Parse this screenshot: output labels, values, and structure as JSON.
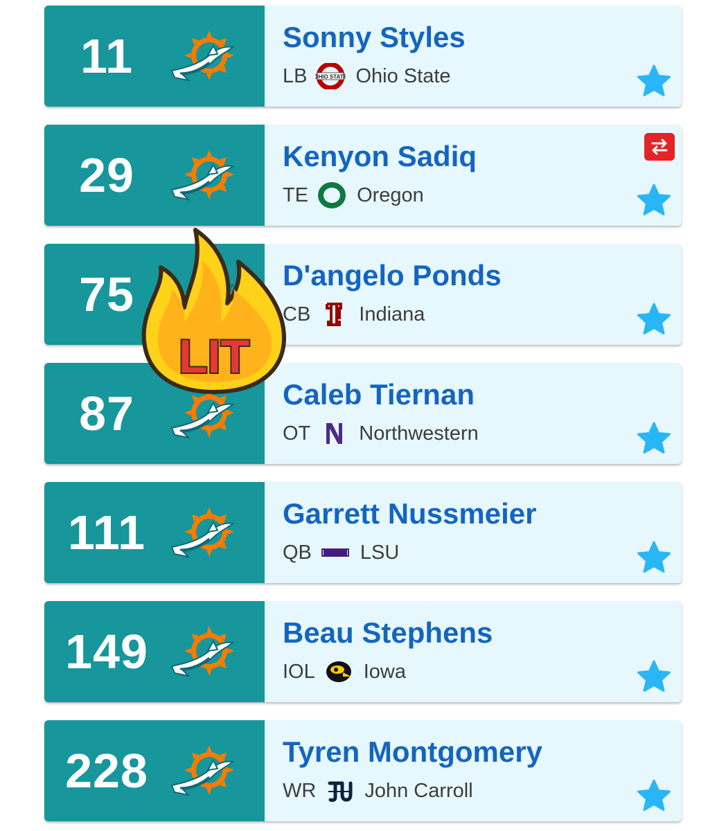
{
  "colors": {
    "team_panel": "#17969b",
    "card_bg": "#e6f8fd",
    "name_blue": "#1565c0",
    "star": "#29b6f6",
    "trade_red": "#e42327"
  },
  "sticker": {
    "text": "LIT"
  },
  "picks": [
    {
      "pick": "11",
      "name": "Sonny Styles",
      "position": "LB",
      "school": "Ohio State",
      "school_icon": "ohio-state-logo-icon",
      "trade": false
    },
    {
      "pick": "29",
      "name": "Kenyon Sadiq",
      "position": "TE",
      "school": "Oregon",
      "school_icon": "oregon-logo-icon",
      "trade": true
    },
    {
      "pick": "75",
      "name": "D'angelo Ponds",
      "position": "CB",
      "school": "Indiana",
      "school_icon": "indiana-logo-icon",
      "trade": false
    },
    {
      "pick": "87",
      "name": "Caleb Tiernan",
      "position": "OT",
      "school": "Northwestern",
      "school_icon": "northwestern-logo-icon",
      "trade": false
    },
    {
      "pick": "111",
      "name": "Garrett Nussmeier",
      "position": "QB",
      "school": "LSU",
      "school_icon": "lsu-logo-icon",
      "trade": false
    },
    {
      "pick": "149",
      "name": "Beau Stephens",
      "position": "IOL",
      "school": "Iowa",
      "school_icon": "iowa-hawkeye-logo-icon",
      "trade": false
    },
    {
      "pick": "228",
      "name": "Tyren Montgomery",
      "position": "WR",
      "school": "John Carroll",
      "school_icon": "john-carroll-logo-icon",
      "trade": false
    }
  ]
}
